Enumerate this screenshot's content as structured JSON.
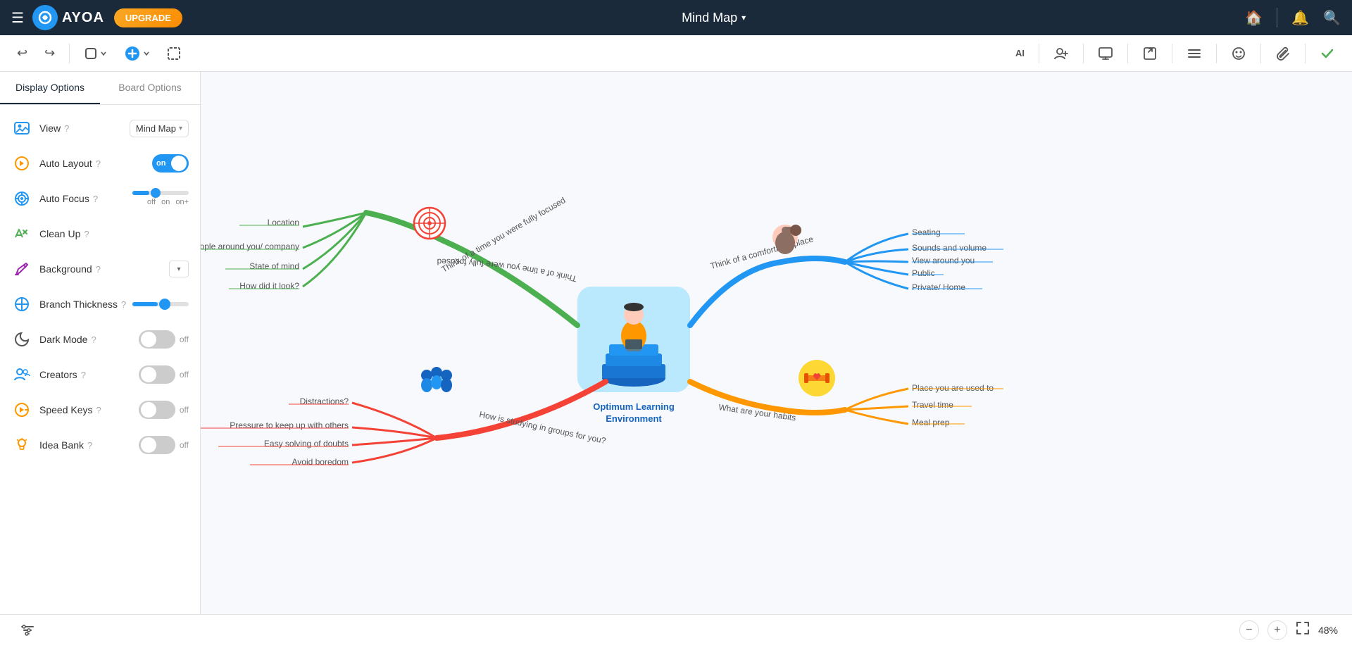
{
  "nav": {
    "menu_label": "☰",
    "logo_text": "AYOA",
    "upgrade_label": "UPGRADE",
    "title": "Mind Map",
    "caret": "▾",
    "icons": {
      "home": "🏠",
      "notification": "🔔",
      "search": "🔍"
    }
  },
  "toolbar": {
    "undo": "↩",
    "redo": "↪",
    "shape_tool": "⬜",
    "add_btn": "+",
    "frame_tool": "⬛",
    "ai_label": "AI",
    "add_user": "👤+",
    "present": "🖥",
    "export": "↗",
    "menu_lines": "≡",
    "sticker": "💬",
    "attachment": "📎",
    "check": "✓"
  },
  "panel": {
    "tab_display": "Display Options",
    "tab_board": "Board Options",
    "rows": [
      {
        "id": "view",
        "icon": "👁",
        "icon_color": "#2196F3",
        "label": "View",
        "help": "?",
        "control_type": "dropdown",
        "value": "Mind Map"
      },
      {
        "id": "auto-layout",
        "icon": "⚡",
        "icon_color": "#FF9800",
        "label": "Auto Layout",
        "help": "?",
        "control_type": "toggle",
        "value": "on",
        "state": true
      },
      {
        "id": "auto-focus",
        "icon": "🎯",
        "icon_color": "#2196F3",
        "label": "Auto Focus",
        "help": "?",
        "control_type": "slider3",
        "labels": [
          "off",
          "on",
          "on+"
        ],
        "position": 1
      },
      {
        "id": "clean-up",
        "icon": "✏",
        "icon_color": "#4CAF50",
        "label": "Clean Up",
        "help": "?",
        "control_type": "none"
      },
      {
        "id": "background",
        "icon": "🖌",
        "icon_color": "#9C27B0",
        "label": "Background",
        "help": "?",
        "control_type": "swatch"
      },
      {
        "id": "branch-thickness",
        "icon": "↔",
        "icon_color": "#2196F3",
        "label": "Branch Thickness",
        "help": "?",
        "control_type": "slider"
      },
      {
        "id": "dark-mode",
        "icon": "🌙",
        "icon_color": "#555",
        "label": "Dark Mode",
        "help": "?",
        "control_type": "toggle_off",
        "value": "off",
        "state": false
      },
      {
        "id": "creators",
        "icon": "👥",
        "icon_color": "#2196F3",
        "label": "Creators",
        "help": "?",
        "control_type": "toggle_off",
        "value": "off",
        "state": false
      },
      {
        "id": "speed-keys",
        "icon": "⚡",
        "icon_color": "#FF9800",
        "label": "Speed Keys",
        "help": "?",
        "control_type": "toggle_off",
        "value": "off",
        "state": false
      },
      {
        "id": "idea-bank",
        "icon": "💡",
        "icon_color": "#FF9800",
        "label": "Idea Bank",
        "help": "?",
        "control_type": "toggle_off",
        "value": "off",
        "state": false
      }
    ]
  },
  "mind_map": {
    "center_title": "Optimum Learning Environment",
    "branches": [
      {
        "id": "branch1",
        "label": "Think of a time you were fully focused",
        "color": "#4CAF50",
        "children": [
          "Location",
          "People around you/ company",
          "State of mind",
          "How did it look?"
        ]
      },
      {
        "id": "branch2",
        "label": "Think of a comfortable place",
        "color": "#2196F3",
        "children": [
          "Seating",
          "Sounds and volume",
          "View around you",
          "Public",
          "Private/ Home"
        ]
      },
      {
        "id": "branch3",
        "label": "How is studying in groups for you?",
        "color": "#f44336",
        "children": [
          "Distractions?",
          "Pressure to keep up with others",
          "Easy solving of doubts",
          "Avoid boredom"
        ]
      },
      {
        "id": "branch4",
        "label": "What are your habits",
        "color": "#FF9800",
        "children": [
          "Place you are used to",
          "Travel time",
          "Meal prep"
        ]
      }
    ]
  },
  "bottom": {
    "filter_icon": "⚙",
    "zoom_out": "−",
    "zoom_in": "+",
    "fit_icon": "⛶",
    "zoom_level": "48%"
  }
}
